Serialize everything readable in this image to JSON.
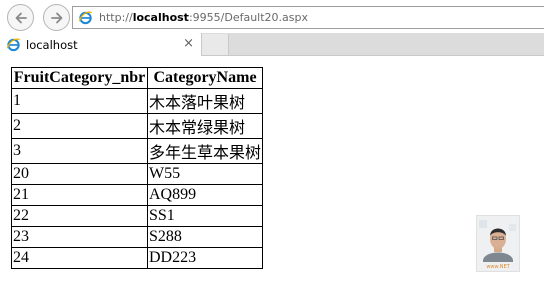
{
  "browser": {
    "address_prefix": "http://",
    "address_host": "localhost",
    "address_rest": ":9955/Default20.aspx",
    "tab_label": "localhost",
    "tab_close": "×"
  },
  "table": {
    "headers": [
      "FruitCategory_nbr",
      "CategoryName"
    ],
    "rows": [
      [
        "1",
        "木本落叶果树"
      ],
      [
        "2",
        "木本常绿果树"
      ],
      [
        "3",
        "多年生草本果树"
      ],
      [
        "20",
        "W55"
      ],
      [
        "21",
        "AQ899"
      ],
      [
        "22",
        "SS1"
      ],
      [
        "23",
        "S288"
      ],
      [
        "24",
        "DD223"
      ]
    ]
  },
  "avatar": {
    "caption": "www.NET"
  }
}
